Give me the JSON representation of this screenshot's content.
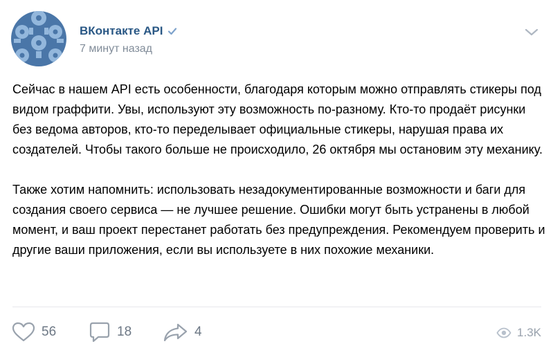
{
  "post": {
    "author_name": "ВКонтакте API",
    "verified": true,
    "timestamp": "7 минут назад",
    "paragraphs": [
      "Сейчас в нашем API есть особенности, благодаря которым можно отправлять стикеры под видом граффити. Увы, используют эту возможность по-разному. Кто-то продаёт рисунки без ведома авторов, кто-то переделывает официальные стикеры, нарушая права их создателей. Чтобы такого больше не происходило, 26 октября мы остановим эту механику.",
      "Также хотим напомнить: использовать незадокументированные возможности и баги для создания своего сервиса — не лучшее решение. Ошибки могут быть устранены в любой момент, и ваш проект перестанет работать без предупреждения. Рекомендуем проверить и другие ваши приложения, если вы используете в них похожие механики."
    ]
  },
  "actions": {
    "likes": "56",
    "comments": "18",
    "shares": "4",
    "views": "1.3K"
  },
  "icons": {
    "avatar": "gear-pattern-avatar",
    "verified": "verified-check-icon",
    "menu": "chevron-down-icon",
    "like": "heart-icon",
    "comment": "comment-bubble-icon",
    "share": "share-arrow-icon",
    "views": "eye-icon"
  },
  "colors": {
    "author_link": "#2a5885",
    "verified": "#7fa3cc",
    "secondary_text": "#818c99",
    "action_icon": "#99a2ad",
    "avatar_light": "#93b7dc",
    "avatar_dark": "#4a76a8"
  }
}
